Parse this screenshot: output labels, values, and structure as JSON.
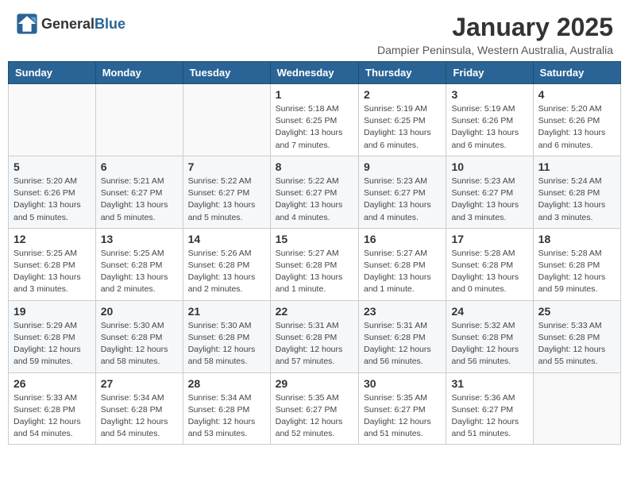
{
  "header": {
    "logo_general": "General",
    "logo_blue": "Blue",
    "month_year": "January 2025",
    "location": "Dampier Peninsula, Western Australia, Australia"
  },
  "days_of_week": [
    "Sunday",
    "Monday",
    "Tuesday",
    "Wednesday",
    "Thursday",
    "Friday",
    "Saturday"
  ],
  "weeks": [
    {
      "days": [
        {
          "number": "",
          "info": ""
        },
        {
          "number": "",
          "info": ""
        },
        {
          "number": "",
          "info": ""
        },
        {
          "number": "1",
          "info": "Sunrise: 5:18 AM\nSunset: 6:25 PM\nDaylight: 13 hours\nand 7 minutes."
        },
        {
          "number": "2",
          "info": "Sunrise: 5:19 AM\nSunset: 6:25 PM\nDaylight: 13 hours\nand 6 minutes."
        },
        {
          "number": "3",
          "info": "Sunrise: 5:19 AM\nSunset: 6:26 PM\nDaylight: 13 hours\nand 6 minutes."
        },
        {
          "number": "4",
          "info": "Sunrise: 5:20 AM\nSunset: 6:26 PM\nDaylight: 13 hours\nand 6 minutes."
        }
      ]
    },
    {
      "days": [
        {
          "number": "5",
          "info": "Sunrise: 5:20 AM\nSunset: 6:26 PM\nDaylight: 13 hours\nand 5 minutes."
        },
        {
          "number": "6",
          "info": "Sunrise: 5:21 AM\nSunset: 6:27 PM\nDaylight: 13 hours\nand 5 minutes."
        },
        {
          "number": "7",
          "info": "Sunrise: 5:22 AM\nSunset: 6:27 PM\nDaylight: 13 hours\nand 5 minutes."
        },
        {
          "number": "8",
          "info": "Sunrise: 5:22 AM\nSunset: 6:27 PM\nDaylight: 13 hours\nand 4 minutes."
        },
        {
          "number": "9",
          "info": "Sunrise: 5:23 AM\nSunset: 6:27 PM\nDaylight: 13 hours\nand 4 minutes."
        },
        {
          "number": "10",
          "info": "Sunrise: 5:23 AM\nSunset: 6:27 PM\nDaylight: 13 hours\nand 3 minutes."
        },
        {
          "number": "11",
          "info": "Sunrise: 5:24 AM\nSunset: 6:28 PM\nDaylight: 13 hours\nand 3 minutes."
        }
      ]
    },
    {
      "days": [
        {
          "number": "12",
          "info": "Sunrise: 5:25 AM\nSunset: 6:28 PM\nDaylight: 13 hours\nand 3 minutes."
        },
        {
          "number": "13",
          "info": "Sunrise: 5:25 AM\nSunset: 6:28 PM\nDaylight: 13 hours\nand 2 minutes."
        },
        {
          "number": "14",
          "info": "Sunrise: 5:26 AM\nSunset: 6:28 PM\nDaylight: 13 hours\nand 2 minutes."
        },
        {
          "number": "15",
          "info": "Sunrise: 5:27 AM\nSunset: 6:28 PM\nDaylight: 13 hours\nand 1 minute."
        },
        {
          "number": "16",
          "info": "Sunrise: 5:27 AM\nSunset: 6:28 PM\nDaylight: 13 hours\nand 1 minute."
        },
        {
          "number": "17",
          "info": "Sunrise: 5:28 AM\nSunset: 6:28 PM\nDaylight: 13 hours\nand 0 minutes."
        },
        {
          "number": "18",
          "info": "Sunrise: 5:28 AM\nSunset: 6:28 PM\nDaylight: 12 hours\nand 59 minutes."
        }
      ]
    },
    {
      "days": [
        {
          "number": "19",
          "info": "Sunrise: 5:29 AM\nSunset: 6:28 PM\nDaylight: 12 hours\nand 59 minutes."
        },
        {
          "number": "20",
          "info": "Sunrise: 5:30 AM\nSunset: 6:28 PM\nDaylight: 12 hours\nand 58 minutes."
        },
        {
          "number": "21",
          "info": "Sunrise: 5:30 AM\nSunset: 6:28 PM\nDaylight: 12 hours\nand 58 minutes."
        },
        {
          "number": "22",
          "info": "Sunrise: 5:31 AM\nSunset: 6:28 PM\nDaylight: 12 hours\nand 57 minutes."
        },
        {
          "number": "23",
          "info": "Sunrise: 5:31 AM\nSunset: 6:28 PM\nDaylight: 12 hours\nand 56 minutes."
        },
        {
          "number": "24",
          "info": "Sunrise: 5:32 AM\nSunset: 6:28 PM\nDaylight: 12 hours\nand 56 minutes."
        },
        {
          "number": "25",
          "info": "Sunrise: 5:33 AM\nSunset: 6:28 PM\nDaylight: 12 hours\nand 55 minutes."
        }
      ]
    },
    {
      "days": [
        {
          "number": "26",
          "info": "Sunrise: 5:33 AM\nSunset: 6:28 PM\nDaylight: 12 hours\nand 54 minutes."
        },
        {
          "number": "27",
          "info": "Sunrise: 5:34 AM\nSunset: 6:28 PM\nDaylight: 12 hours\nand 54 minutes."
        },
        {
          "number": "28",
          "info": "Sunrise: 5:34 AM\nSunset: 6:28 PM\nDaylight: 12 hours\nand 53 minutes."
        },
        {
          "number": "29",
          "info": "Sunrise: 5:35 AM\nSunset: 6:27 PM\nDaylight: 12 hours\nand 52 minutes."
        },
        {
          "number": "30",
          "info": "Sunrise: 5:35 AM\nSunset: 6:27 PM\nDaylight: 12 hours\nand 51 minutes."
        },
        {
          "number": "31",
          "info": "Sunrise: 5:36 AM\nSunset: 6:27 PM\nDaylight: 12 hours\nand 51 minutes."
        },
        {
          "number": "",
          "info": ""
        }
      ]
    }
  ]
}
